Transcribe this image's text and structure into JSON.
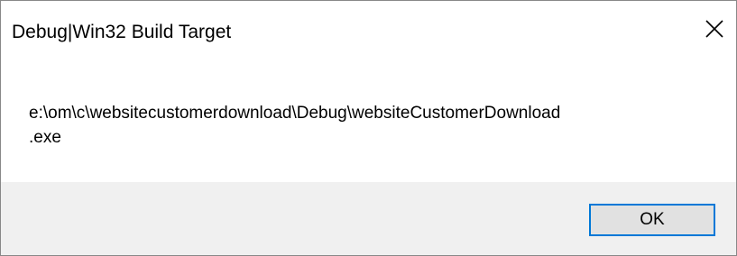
{
  "dialog": {
    "title": "Debug|Win32 Build Target",
    "message_line1": "e:\\om\\c\\websitecustomerdownload\\Debug\\websiteCustomerDownload",
    "message_line2": ".exe",
    "ok_label": "OK",
    "close_icon": "close-icon"
  },
  "colors": {
    "footer_bg": "#f0f0f0",
    "button_border": "#0078d7",
    "button_bg": "#e1e1e1"
  }
}
